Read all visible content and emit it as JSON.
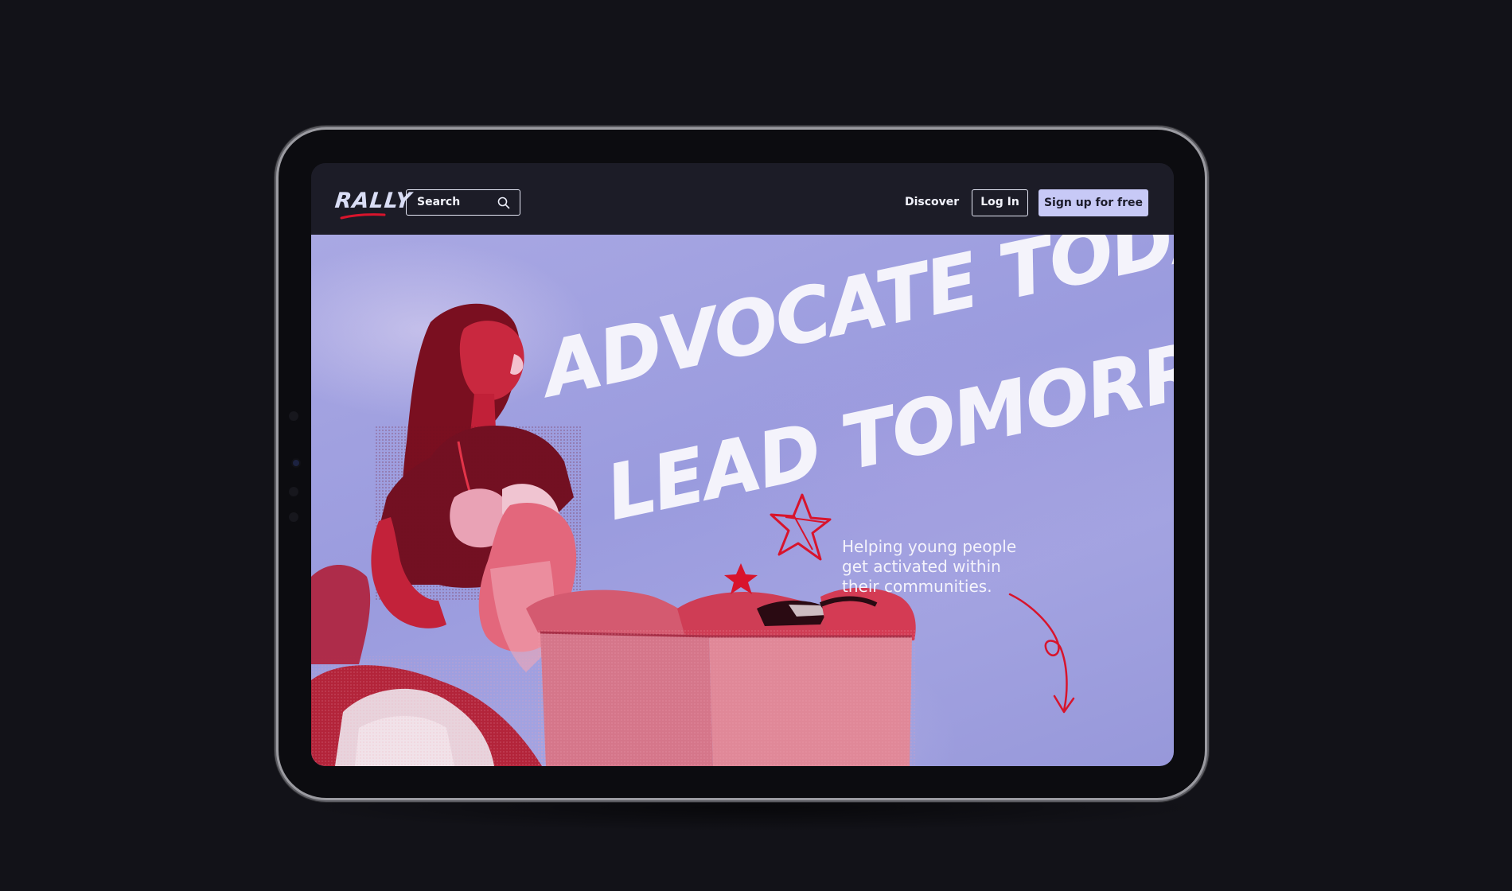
{
  "header": {
    "logo_text": "RALLY",
    "search": {
      "label": "Search"
    },
    "nav": {
      "discover_label": "Discover",
      "login_label": "Log In",
      "signup_label": "Sign up for free"
    }
  },
  "hero": {
    "headline_line1": "ADVOCATE TODAY",
    "headline_line2": "LEAD TOMORROW",
    "tagline_line1": "Helping young people",
    "tagline_line2": "get activated within",
    "tagline_line3": "their communities."
  },
  "colors": {
    "page_background": "#121218",
    "navbar": "#1c1c27",
    "hero_background": "#9b9bdd",
    "accent_red": "#d8142c",
    "signup_button": "#c7c9f6"
  },
  "icons": {
    "search": "search-icon",
    "star_outline": "star-outline-icon",
    "star_filled": "star-filled-icon",
    "arrow": "squiggle-arrow-icon"
  }
}
